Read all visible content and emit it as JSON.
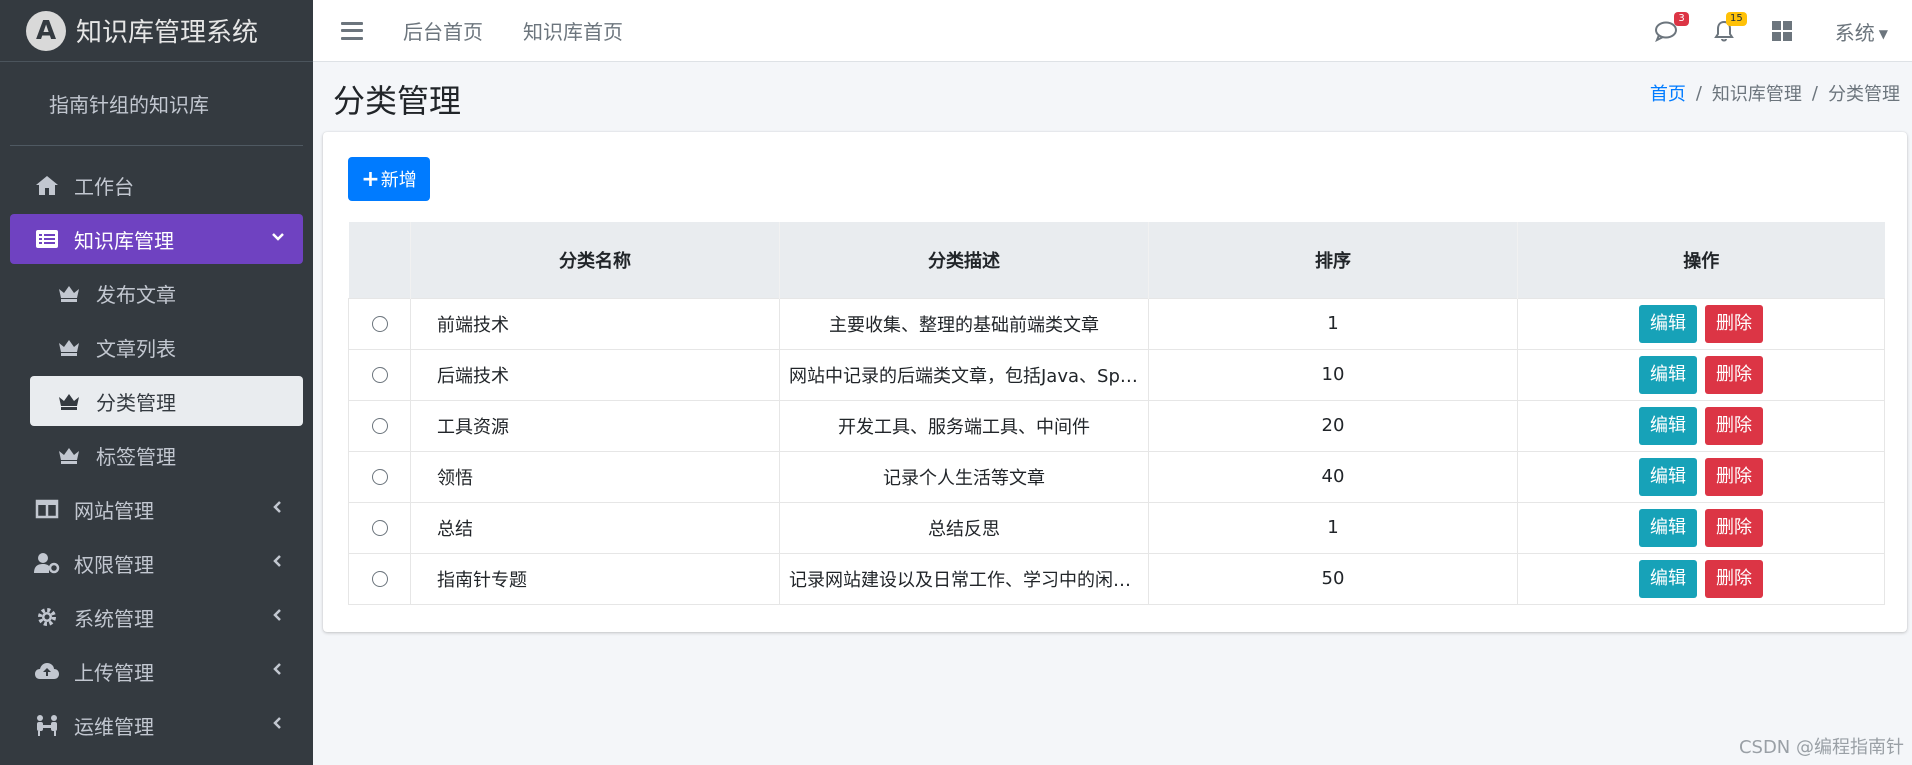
{
  "brand": {
    "title": "知识库管理系统",
    "logo_letter": "A"
  },
  "user_panel": {
    "name": "指南针组的知识库"
  },
  "sidebar": {
    "items": [
      {
        "label": "工作台",
        "icon": "home-icon"
      },
      {
        "label": "知识库管理",
        "icon": "list-icon",
        "active": true,
        "children": [
          {
            "label": "发布文章",
            "icon": "crown-icon"
          },
          {
            "label": "文章列表",
            "icon": "crown-icon"
          },
          {
            "label": "分类管理",
            "icon": "crown-icon",
            "current": true
          },
          {
            "label": "标签管理",
            "icon": "crown-icon"
          }
        ]
      },
      {
        "label": "网站管理",
        "icon": "columns-icon"
      },
      {
        "label": "权限管理",
        "icon": "user-cog-icon"
      },
      {
        "label": "系统管理",
        "icon": "gear-icon"
      },
      {
        "label": "上传管理",
        "icon": "cloud-upload-icon"
      },
      {
        "label": "运维管理",
        "icon": "people-icon"
      }
    ]
  },
  "topbar": {
    "links": [
      "后台首页",
      "知识库首页"
    ],
    "messages_badge": "3",
    "notifications_badge": "15",
    "system_label": "系统"
  },
  "header": {
    "title": "分类管理",
    "breadcrumb": [
      "首页",
      "知识库管理",
      "分类管理"
    ]
  },
  "toolbar": {
    "add_label": "新增"
  },
  "table": {
    "columns": [
      "分类名称",
      "分类描述",
      "排序",
      "操作"
    ],
    "rows": [
      {
        "name": "前端技术",
        "desc": "主要收集、整理的基础前端类文章",
        "sort": "1"
      },
      {
        "name": "后端技术",
        "desc": "网站中记录的后端类文章，包括Java、Sprin...",
        "sort": "10"
      },
      {
        "name": "工具资源",
        "desc": "开发工具、服务端工具、中间件",
        "sort": "20"
      },
      {
        "name": "领悟",
        "desc": "记录个人生活等文章",
        "sort": "40"
      },
      {
        "name": "总结",
        "desc": "总结反思",
        "sort": "1"
      },
      {
        "name": "指南针专题",
        "desc": "记录网站建设以及日常工作、学习中的闲言...",
        "sort": "50"
      }
    ],
    "edit_label": "编辑",
    "delete_label": "删除"
  },
  "watermark": "CSDN @编程指南针",
  "colors": {
    "sidebar_bg": "#343a40",
    "active_bg": "#6f42c1",
    "primary": "#007bff",
    "info": "#17a2b8",
    "danger": "#dc3545"
  }
}
